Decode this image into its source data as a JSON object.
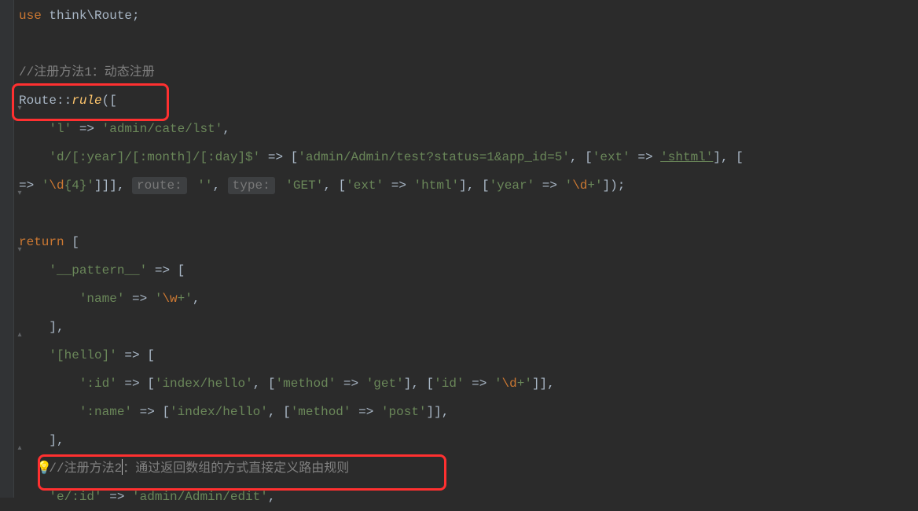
{
  "code": {
    "line1_use": "use",
    "line1_class": " think\\Route",
    "line1_semi": ";",
    "comment1": "//注册方法1：动态注册",
    "route_class": "Route",
    "dbl_colon": "::",
    "rule_method": "rule",
    "open_br": "([",
    "arr1_key": "'l'",
    "arrow": " => ",
    "arr1_val": "'admin/cate/lst'",
    "arr1_comma": ",",
    "line_d_pattern": "'d/[:year]/[:month]/[:day]$'",
    "line_d_arr_open": " => [",
    "line_d_route": "'admin/Admin/test?status=1&app_id=5'",
    "line_d_mid": ", [",
    "line_d_extkey": "'ext'",
    "line_d_extval": "'shtml'",
    "line_d_close": "], [",
    "line_e_prefix": "=> ",
    "line_e_regex": "'\\d{4}'",
    "line_e_close1": "]]], ",
    "hint_route": "route:",
    "line_e_empty": "''",
    "line_e_comma1": ", ",
    "hint_type": "type:",
    "line_e_get": "'GET'",
    "line_e_comma2": ", [",
    "line_e_extkey": "'ext'",
    "line_e_extval": "'html'",
    "line_e_mid2": "], [",
    "line_e_yearkey": "'year'",
    "line_e_yearval": "'\\d+'",
    "line_e_end": "]);",
    "return_kw": "return",
    "return_open": " [",
    "pattern_key": "'__pattern__'",
    "pattern_open": " => [",
    "name_key": "'name'",
    "name_val": "'\\w+'",
    "name_comma": ",",
    "close_bracket": "],",
    "hello_key": "'[hello]'",
    "hello_open": " => [",
    "id_key": "':id'",
    "id_arr_open": " => [",
    "id_route": "'index/hello'",
    "id_mid1": ", [",
    "method_key": "'method'",
    "method_get": "'get'",
    "id_mid2": "], [",
    "id_key2": "'id'",
    "id_regex": "'\\d+'",
    "id_close": "]],",
    "nameroute_key": "':name'",
    "nameroute_open": " => [",
    "nameroute_route": "'index/hello'",
    "nameroute_mid": ", [",
    "method_post": "'post'",
    "nameroute_close": "]],",
    "comment2_pre": "//注册方法2",
    "comment2_post": "：通过返回数组的方式直接定义路由规则",
    "edit_key": "'e/:id'",
    "edit_val": "'admin/Admin/edit'",
    "edit_comma": ","
  }
}
